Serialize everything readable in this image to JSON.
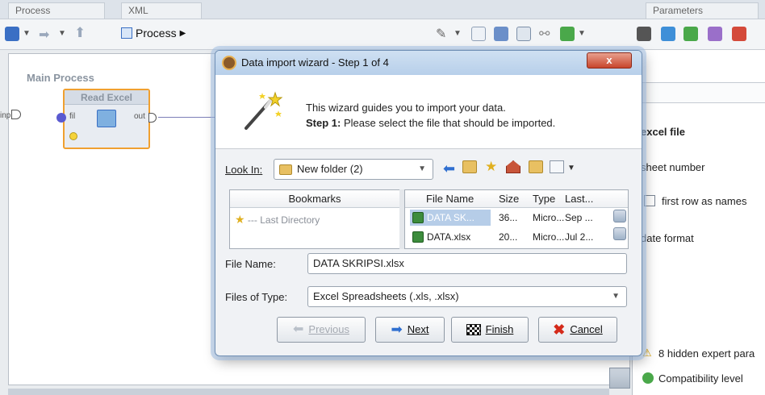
{
  "background": {
    "tabs": [
      "Process",
      "XML",
      "Parameters"
    ],
    "toolbar": {
      "process_label": "Process"
    },
    "main_process_label": "Main Process",
    "operator": {
      "title": "Read Excel",
      "port_in": "fil",
      "port_out": "out",
      "left_port": "inp"
    },
    "params": {
      "excel_file": "excel file",
      "sheet_number": "sheet number",
      "first_row_as_names": "first row as names",
      "date_format": "date format",
      "hidden_expert": "8 hidden expert para",
      "compatibility": "Compatibility level"
    }
  },
  "dialog": {
    "title": "Data import wizard - Step 1 of 4",
    "close_label": "x",
    "intro_line1": "This wizard guides you to import your data.",
    "intro_line2_bold": "Step 1:",
    "intro_line2_rest": " Please select the file that should be imported.",
    "look_in_label": "Look In:",
    "look_in_value": "New folder (2)",
    "bookmarks_header": "Bookmarks",
    "bookmark_item": "--- Last Directory",
    "file_columns": [
      "File Name",
      "Size",
      "Type",
      "Last..."
    ],
    "file_rows": [
      {
        "name": "DATA SK...",
        "size": "36...",
        "type": "Micro...",
        "last": "Sep ..."
      },
      {
        "name": "DATA.xlsx",
        "size": "20...",
        "type": "Micro...",
        "last": "Jul 2..."
      }
    ],
    "file_name_label": "File Name:",
    "file_name_value": "DATA SKRIPSI.xlsx",
    "files_of_type_label": "Files of Type:",
    "files_of_type_value": "Excel Spreadsheets (.xls, .xlsx)",
    "buttons": {
      "previous": "Previous",
      "next": "Next",
      "finish": "Finish",
      "cancel": "Cancel"
    }
  },
  "colors": {
    "operator_border": "#f0a030",
    "close": "#c8452c",
    "next_arrow": "#2f6fd0"
  }
}
